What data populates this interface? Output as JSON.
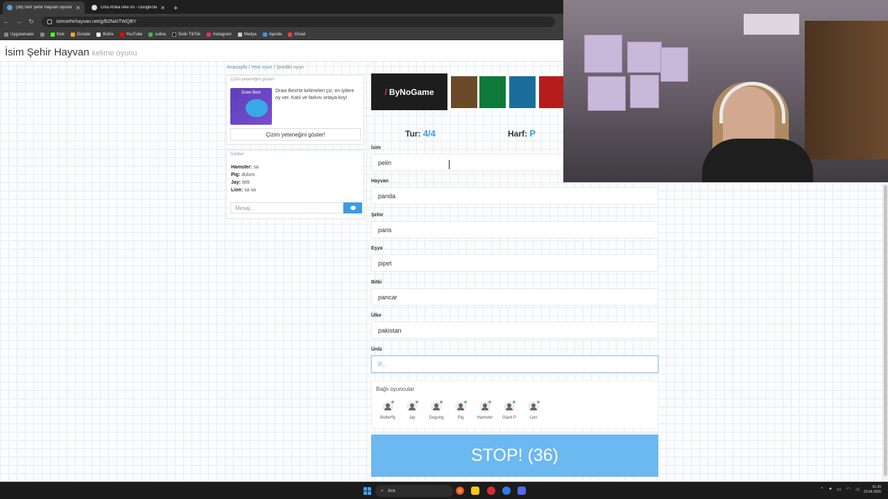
{
  "browser": {
    "tabs": [
      {
        "title": "(36) İsim Şehir Hayvan oyunun",
        "active": true
      },
      {
        "title": "Orta Afrika ülke mi - Google'da",
        "active": false
      }
    ],
    "new_tab": "+",
    "url": "isimsehirhayvan.net/g/B2NAITWQBY",
    "bookmarks": [
      "Uygulamalar",
      "Kick",
      "Donate",
      "Botrix",
      "YouTube",
      "sulina",
      "Sulin TikTok",
      "Instagram",
      "Medya",
      "Ajanda",
      "Gmail"
    ]
  },
  "site": {
    "brand": "İsim Şehir Hayvan",
    "brand_sub": "kelime oyunu"
  },
  "breadcrumb": {
    "home": "Anasayfa",
    "sep1": "/",
    "new_game": "Yeni oyun",
    "sep2": "/",
    "current": "Şimdiki oyun"
  },
  "drawbest": {
    "title": "Çizim yeteneğini göster!",
    "thumb_title": "Draw Best",
    "description": "Draw Best'te kelimeleri çiz, en iyilere oy ver. Katıl ve farkını ortaya koy!",
    "button": "Çizim yeteneğini göster!"
  },
  "chat": {
    "title": "Sohbet",
    "messages": [
      {
        "user": "Hamster:",
        "text": "sa"
      },
      {
        "user": "Pig:",
        "text": "dulum"
      },
      {
        "user": "Jay:",
        "text": "bitti"
      },
      {
        "user": "Lion:",
        "text": "sa sa"
      }
    ],
    "placeholder": "Mesaj..."
  },
  "ad": {
    "logo": "ByNoGame",
    "logo_mark": "/"
  },
  "game": {
    "round_label": "Tur:",
    "round_value": "4/4",
    "letter_label": "Harf:",
    "letter_value": "P"
  },
  "fields": [
    {
      "label": "İsim",
      "value": "pelin"
    },
    {
      "label": "Hayvan",
      "value": "panda"
    },
    {
      "label": "Şehir",
      "value": "paris"
    },
    {
      "label": "Eşya",
      "value": "pipet"
    },
    {
      "label": "Bitki",
      "value": "pancar"
    },
    {
      "label": "Ülke",
      "value": "pakistan"
    },
    {
      "label": "Ünlü",
      "value": "",
      "placeholder": "P..."
    }
  ],
  "players": {
    "title": "Bağlı oyuncular",
    "list": [
      "Butterfly",
      "Jay",
      "Dugong",
      "Pig",
      "Hamster",
      "Giant P",
      "Lion"
    ]
  },
  "stop_button": "STOP! (36)",
  "taskbar": {
    "search": "Ara",
    "time": "01:30",
    "date": "23.04.2026"
  },
  "colors": {
    "accent": "#3c9be8",
    "stop": "#6cb8f0"
  }
}
